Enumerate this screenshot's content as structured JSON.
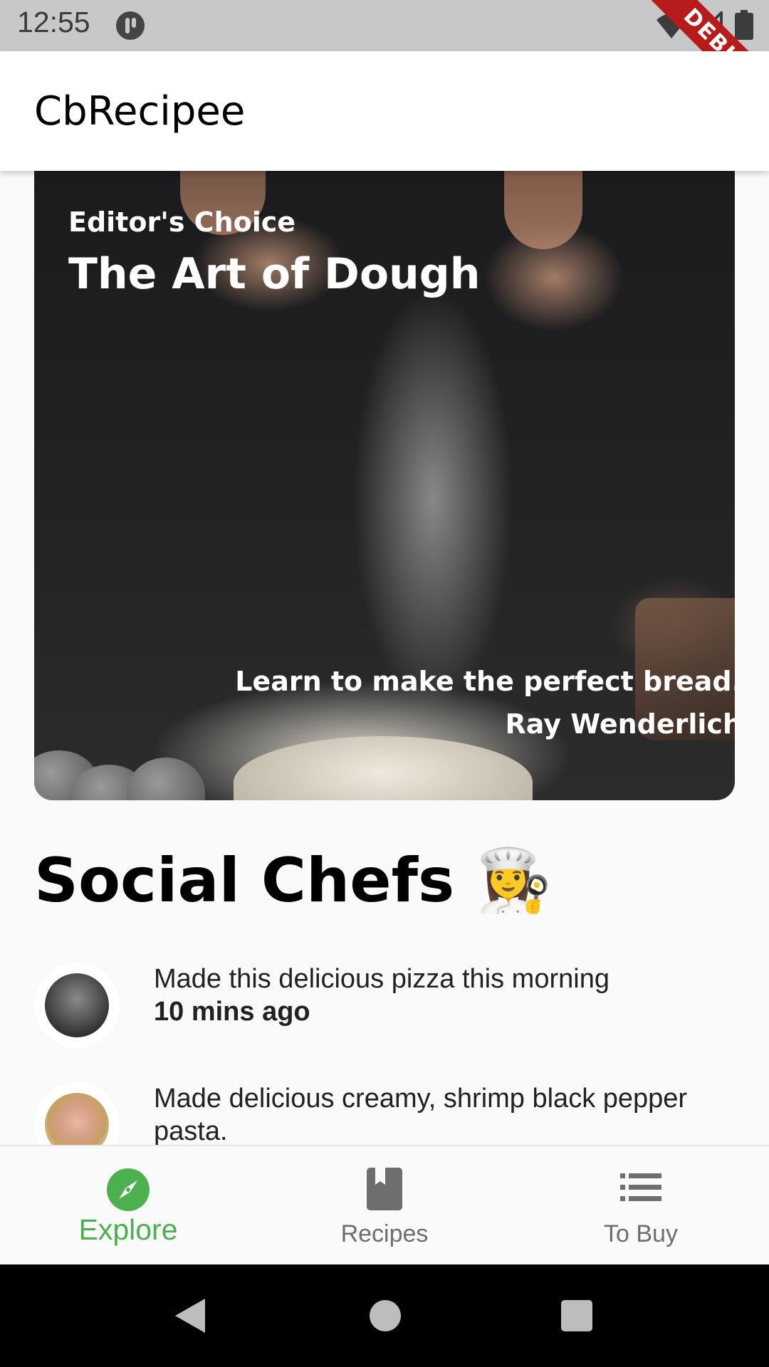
{
  "status_bar": {
    "time": "12:55",
    "debug_label": "DEBUG"
  },
  "app_bar": {
    "title": "CbRecipee"
  },
  "hero": {
    "category": "Editor's Choice",
    "title": "The Art of Dough",
    "subtitle": "Learn to make the perfect bread.",
    "author": "Ray Wenderlich"
  },
  "social": {
    "title": "Social Chefs 👩‍🍳",
    "posts": [
      {
        "text": "Made this delicious pizza this morning",
        "time": "10 mins ago"
      },
      {
        "text": "Made delicious creamy, shrimp black pepper pasta."
      }
    ]
  },
  "bottom_nav": {
    "items": [
      {
        "label": "Explore",
        "icon": "compass-icon",
        "active": true
      },
      {
        "label": "Recipes",
        "icon": "book-icon",
        "active": false
      },
      {
        "label": "To Buy",
        "icon": "list-icon",
        "active": false
      }
    ]
  },
  "colors": {
    "accent": "#4caf50",
    "inactive": "#6e6e6e",
    "debug": "#b71c1c"
  }
}
